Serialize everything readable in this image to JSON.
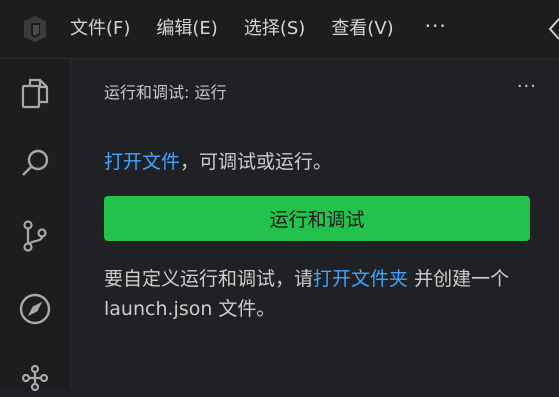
{
  "menu": {
    "items": [
      "文件(F)",
      "编辑(E)",
      "选择(S)",
      "查看(V)"
    ],
    "more": "···"
  },
  "activity_bar": {
    "icons": [
      "explorer-icon",
      "search-icon",
      "source-control-icon",
      "run-debug-icon",
      "extensions-icon"
    ]
  },
  "sidebar": {
    "header": "运行和调试: 运行",
    "more": "···",
    "open_file_link": "打开文件",
    "open_file_rest": "，可调试或运行。",
    "run_button": "运行和调试",
    "custom_text_before": "要自定义运行和调试，请",
    "open_folder_link": "打开文件夹",
    "custom_text_after": " 并创建一个 launch.json 文件。"
  },
  "colors": {
    "accent_green": "#22c24d",
    "link_blue": "#3fa3ff"
  }
}
